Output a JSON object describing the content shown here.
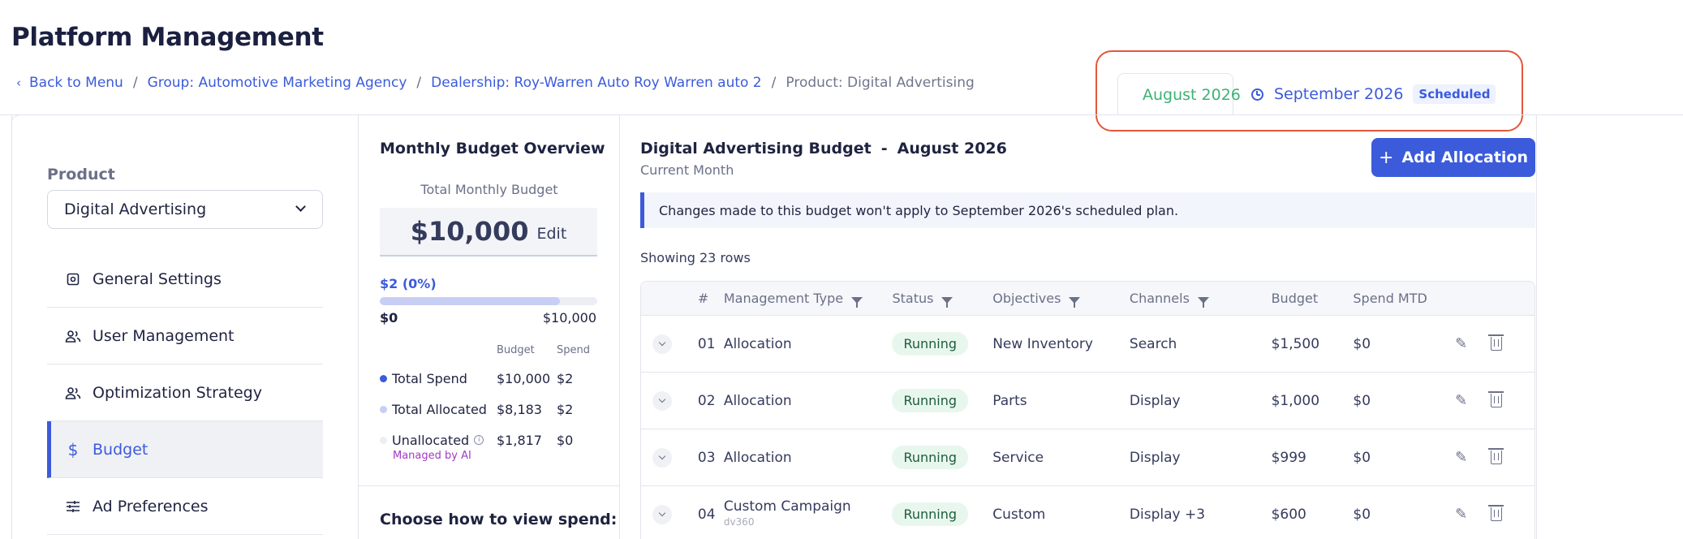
{
  "page_title": "Platform Management",
  "breadcrumb": {
    "back": "Back to Menu",
    "group": "Group: Automotive Marketing Agency",
    "dealership": "Dealership: Roy-Warren Auto Roy Warren auto 2",
    "product": "Product: Digital Advertising"
  },
  "month_tabs": {
    "current": "August 2026",
    "next": "September 2026",
    "next_badge": "Scheduled"
  },
  "sidebar": {
    "product_label": "Product",
    "product_value": "Digital Advertising",
    "items": [
      {
        "label": "General Settings"
      },
      {
        "label": "User Management"
      },
      {
        "label": "Optimization Strategy"
      },
      {
        "label": "Budget"
      },
      {
        "label": "Ad Preferences"
      }
    ]
  },
  "overview": {
    "title": "Monthly Budget Overview",
    "total_label": "Total Monthly Budget",
    "total_amount": "$10,000",
    "edit_label": "Edit",
    "spent_text": "$2 (0%)",
    "bar_fill_fraction": 0.83,
    "min_label": "$0",
    "max_label": "$10,000",
    "col_budget": "Budget",
    "col_spend": "Spend",
    "rows": [
      {
        "label": "Total Spend",
        "budget": "$10,000",
        "spend": "$2",
        "color": "#3b5bdb"
      },
      {
        "label": "Total Allocated",
        "budget": "$8,183",
        "spend": "$2",
        "color": "#c7cff5"
      },
      {
        "label": "Unallocated",
        "budget": "$1,817",
        "spend": "$0",
        "color": "#eceef4"
      }
    ],
    "managed_by_ai": "Managed by AI",
    "choose_title": "Choose how to view spend:"
  },
  "panel": {
    "title": "Digital Advertising Budget",
    "title_month": "August 2026",
    "subtitle": "Current Month",
    "add_button": "Add Allocation",
    "notice": "Changes made to this budget won't apply to September 2026's scheduled plan.",
    "showing": "Showing 23 rows",
    "columns": {
      "num": "#",
      "type": "Management Type",
      "status": "Status",
      "objectives": "Objectives",
      "channels": "Channels",
      "budget": "Budget",
      "spend": "Spend MTD"
    },
    "rows": [
      {
        "num": "01",
        "type": "Allocation",
        "type_sub": "",
        "status": "Running",
        "objective": "New Inventory",
        "channel": "Search",
        "budget": "$1,500",
        "spend": "$0"
      },
      {
        "num": "02",
        "type": "Allocation",
        "type_sub": "",
        "status": "Running",
        "objective": "Parts",
        "channel": "Display",
        "budget": "$1,000",
        "spend": "$0"
      },
      {
        "num": "03",
        "type": "Allocation",
        "type_sub": "",
        "status": "Running",
        "objective": "Service",
        "channel": "Display",
        "budget": "$999",
        "spend": "$0"
      },
      {
        "num": "04",
        "type": "Custom Campaign",
        "type_sub": "dv360",
        "status": "Running",
        "objective": "Custom",
        "channel": "Display +3",
        "budget": "$600",
        "spend": "$0"
      }
    ]
  },
  "colors": {
    "accent": "#3b5bdb",
    "current_month": "#3bb273",
    "highlight_border": "#e5563a",
    "running_bg": "#e8f7ee",
    "ai_label": "#a338c9"
  }
}
